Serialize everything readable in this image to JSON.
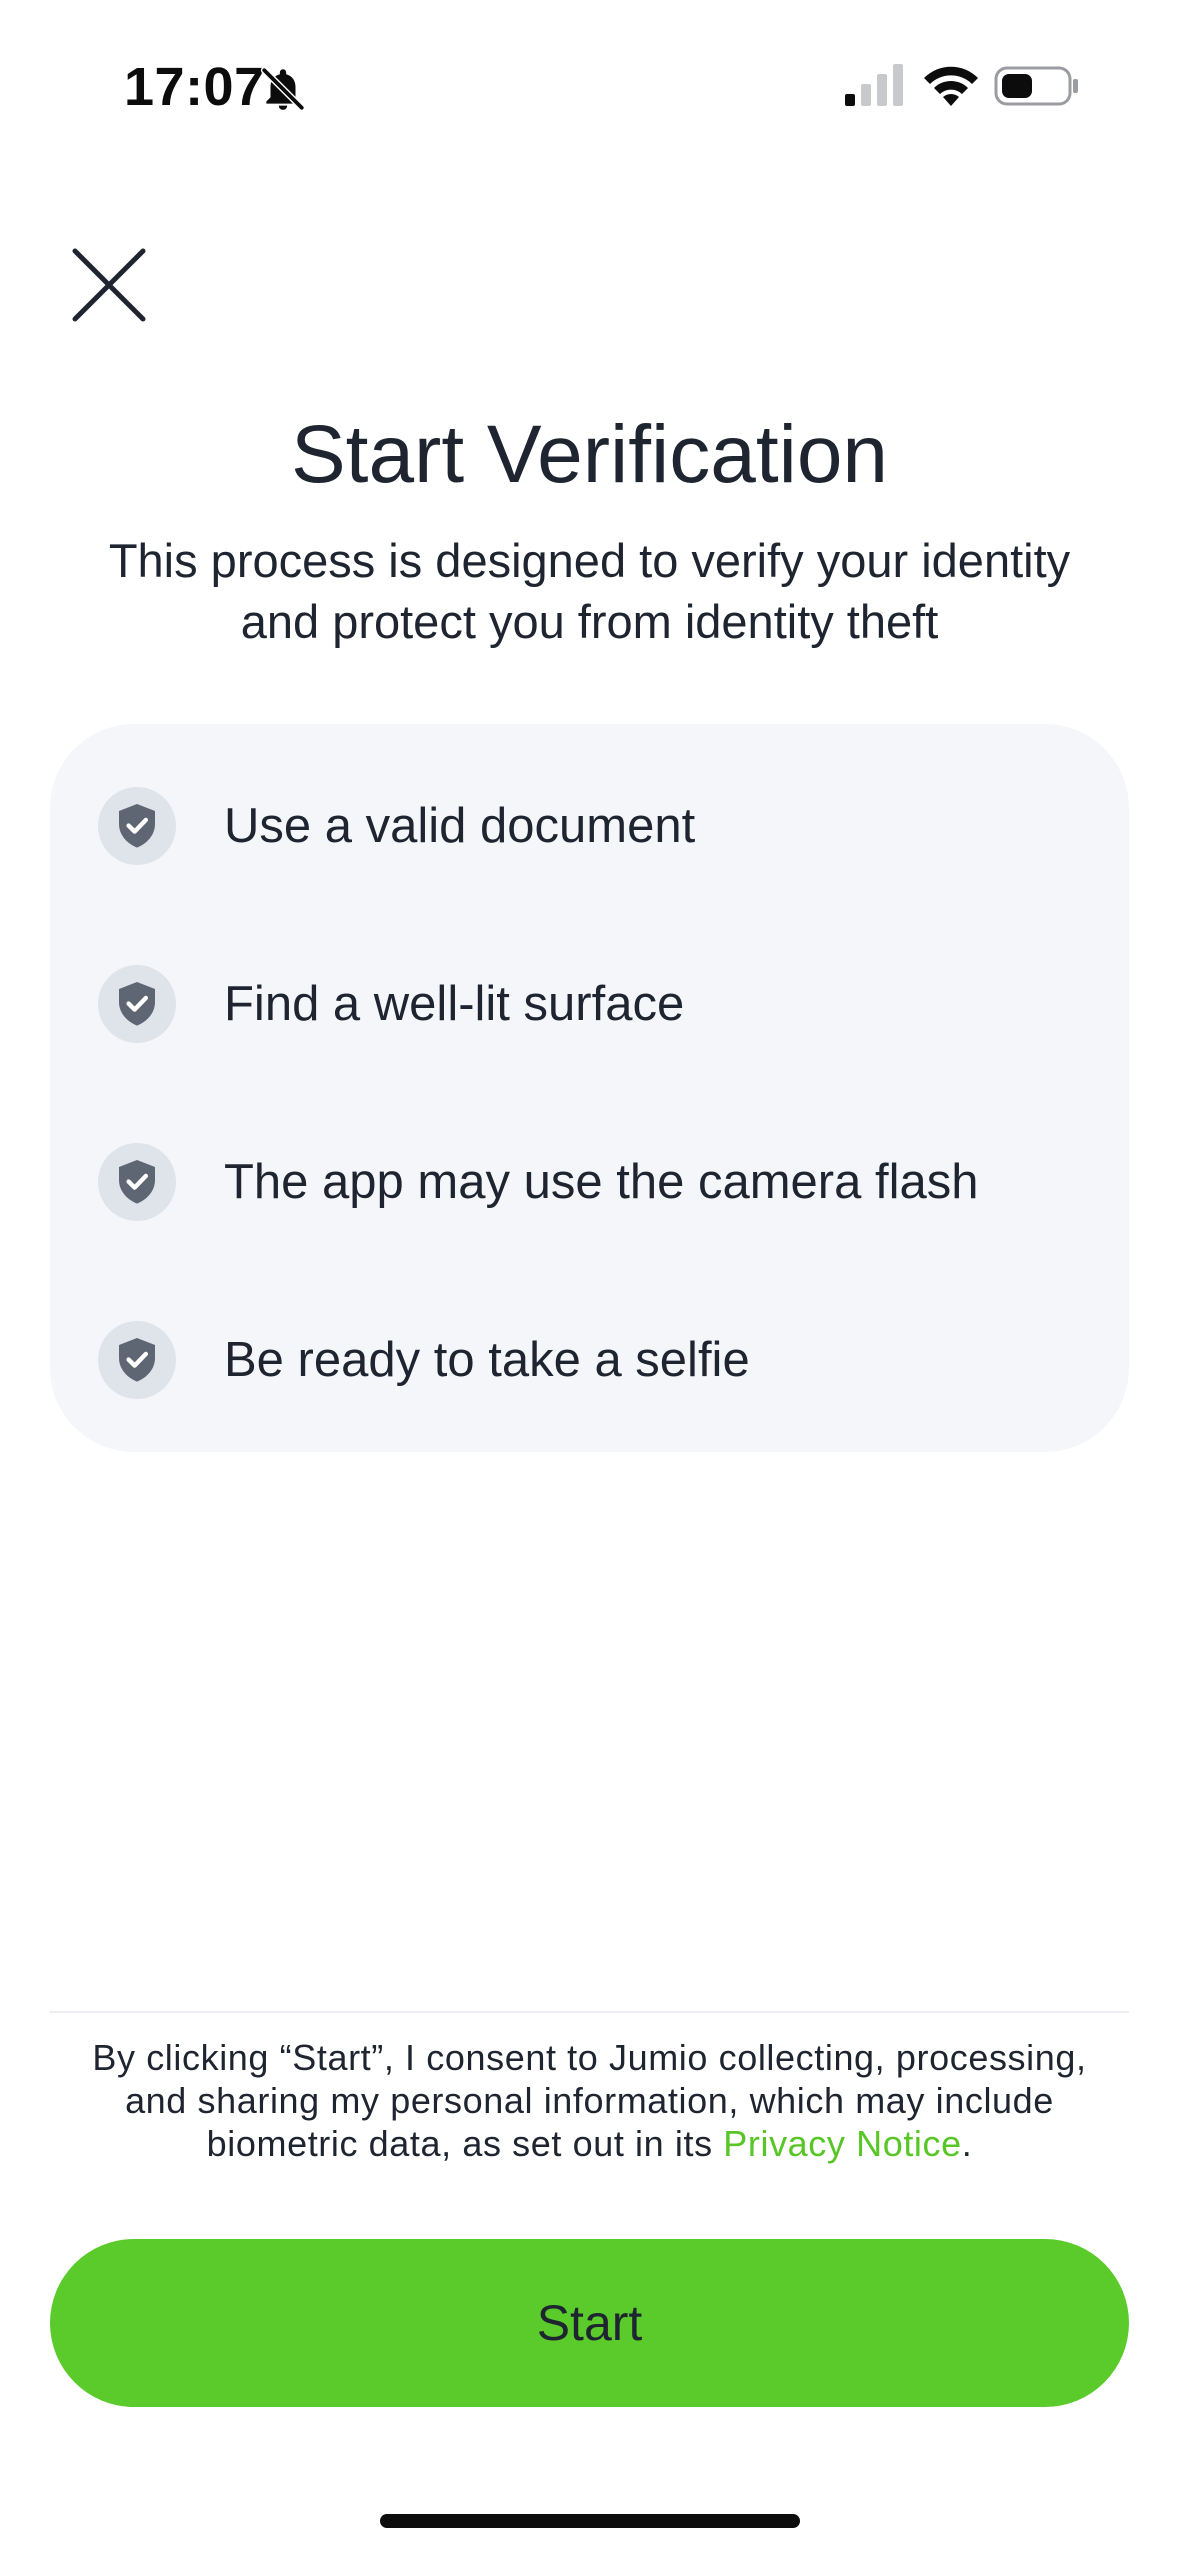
{
  "status_bar": {
    "time": "17:07",
    "icons": [
      "bell-slash-icon",
      "cellular-signal-icon",
      "wifi-icon",
      "battery-icon"
    ]
  },
  "header": {
    "close_icon": "close-icon"
  },
  "main": {
    "title": "Start Verification",
    "subtitle": "This process is designed to verify your identity and protect you from identity theft",
    "checklist": [
      {
        "icon": "shield-check-icon",
        "label": "Use a valid document"
      },
      {
        "icon": "shield-check-icon",
        "label": "Find a well-lit surface"
      },
      {
        "icon": "shield-check-icon",
        "label": "The app may use the camera flash"
      },
      {
        "icon": "shield-check-icon",
        "label": "Be ready to take a selfie"
      }
    ]
  },
  "footer": {
    "consent_text": "By clicking “Start”, I consent to Jumio collecting, processing, and sharing my personal information, which may include biometric data, as set out in its ",
    "privacy_link": "Privacy Notice",
    "consent_end": ".",
    "start_label": "Start"
  },
  "colors": {
    "accent_green": "#5acb2a",
    "link_green": "#58c626",
    "card_background": "#f4f6fa",
    "text": "#1f2530",
    "shield_fill": "#5f6673",
    "shield_badge": "#dfe3ea"
  }
}
